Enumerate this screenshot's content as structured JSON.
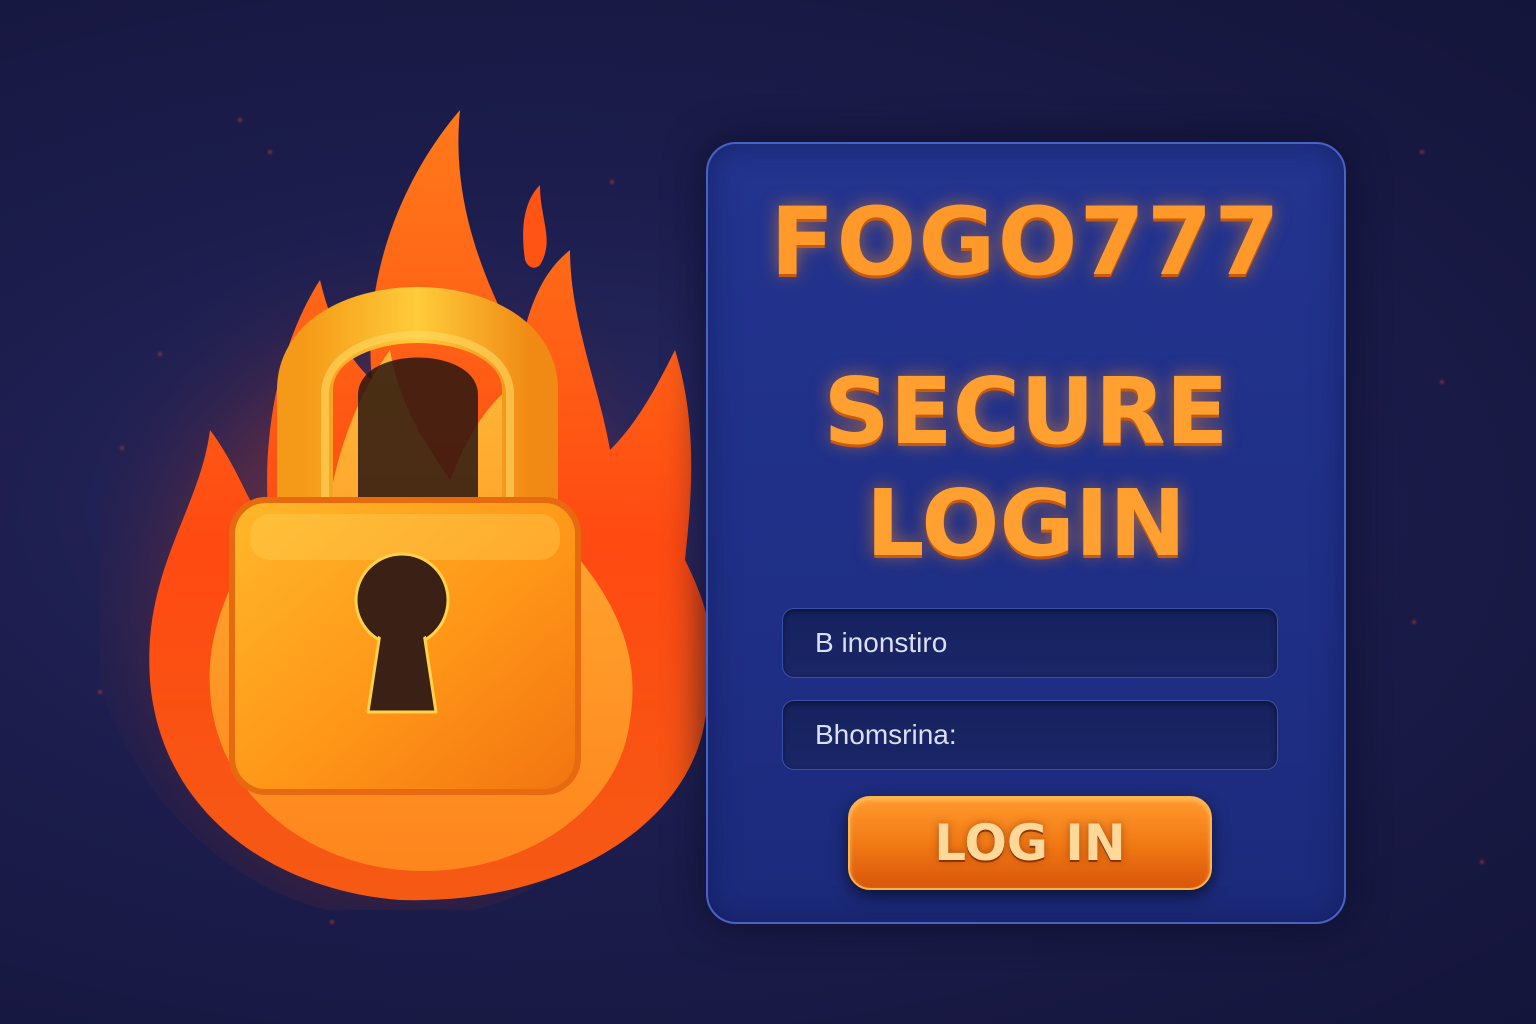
{
  "brand": {
    "name": "FOGO777"
  },
  "login": {
    "headline_line1": "SECURE",
    "headline_line2": "LOGIN",
    "username_placeholder": "B inonstiro",
    "password_placeholder": "Bhomsrina:",
    "submit_label": "LOG IN"
  },
  "icons": {
    "emblem": "flaming-padlock-icon",
    "keyhole": "keyhole-icon"
  },
  "colors": {
    "background": "#1c1d4d",
    "card": "#23348f",
    "accent_text": "#ff9a2a",
    "button": "#f27a14",
    "flame": "#ff5a1a",
    "lock": "#ffb01c"
  }
}
